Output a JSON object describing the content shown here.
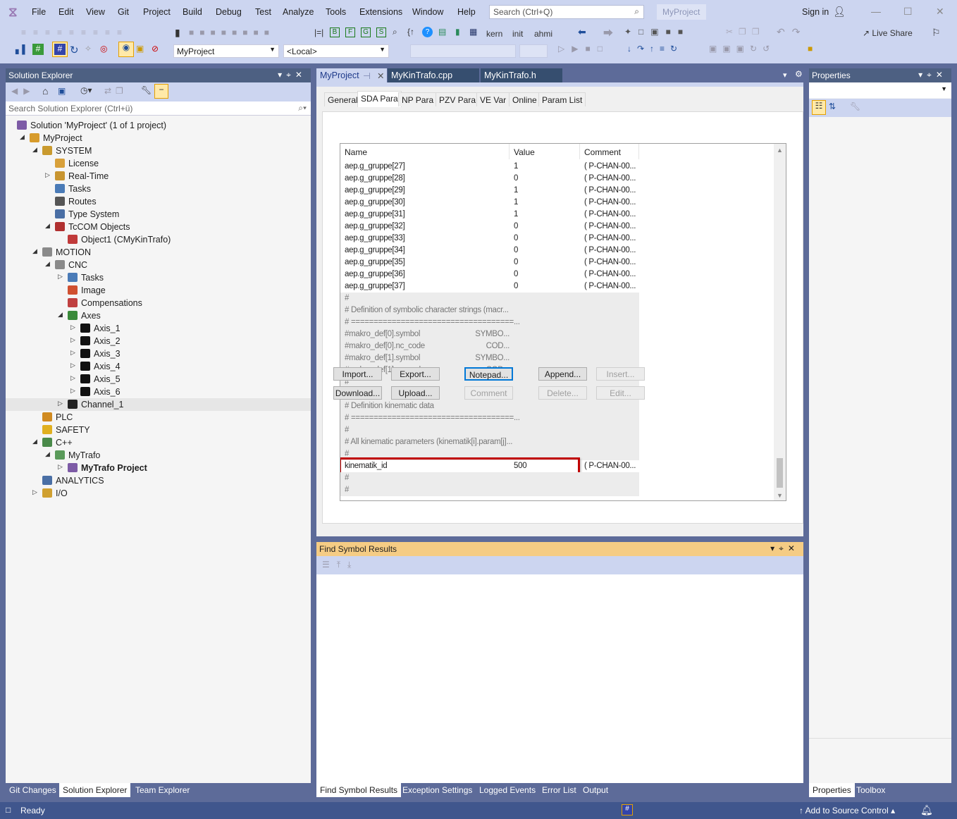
{
  "menu": [
    "File",
    "Edit",
    "View",
    "Git",
    "Project",
    "Build",
    "Debug",
    "Test",
    "Analyze",
    "Tools",
    "Extensions",
    "Window",
    "Help"
  ],
  "search_placeholder": "Search (Ctrl+Q)",
  "project_badge": "MyProject",
  "sign_in": "Sign in",
  "live_share": "Live Share",
  "toolbar": {
    "text_buttons": [
      "kern",
      "init",
      "ahmi"
    ],
    "letter_buttons": [
      "B",
      "F",
      "G",
      "S"
    ],
    "project_combo": "MyProject",
    "target_combo": "<Local>"
  },
  "solution_explorer": {
    "title": "Solution Explorer",
    "search_placeholder": "Search Solution Explorer (Ctrl+ü)",
    "tree": [
      {
        "label": "Solution 'MyProject' (1 of 1 project)",
        "level": 0,
        "exp": "",
        "icon": "solution-icon",
        "color": "#7d5ba6"
      },
      {
        "label": "MyProject",
        "level": 1,
        "exp": "open",
        "icon": "twincat-project-icon",
        "color": "#d79b2b"
      },
      {
        "label": "SYSTEM",
        "level": 2,
        "exp": "open",
        "icon": "system-icon",
        "color": "#c99a2e"
      },
      {
        "label": "License",
        "level": 3,
        "exp": "",
        "icon": "license-icon",
        "color": "#d8a03a"
      },
      {
        "label": "Real-Time",
        "level": 3,
        "exp": "closed",
        "icon": "realtime-icon",
        "color": "#c89530"
      },
      {
        "label": "Tasks",
        "level": 3,
        "exp": "",
        "icon": "tasks-icon",
        "color": "#4a7bb7"
      },
      {
        "label": "Routes",
        "level": 3,
        "exp": "",
        "icon": "routes-icon",
        "color": "#555"
      },
      {
        "label": "Type System",
        "level": 3,
        "exp": "",
        "icon": "type-system-icon",
        "color": "#4a6fa5"
      },
      {
        "label": "TcCOM Objects",
        "level": 3,
        "exp": "open",
        "icon": "tccom-icon",
        "color": "#b03030"
      },
      {
        "label": "Object1 (CMyKinTrafo)",
        "level": 4,
        "exp": "",
        "icon": "object-icon",
        "color": "#c03a3a"
      },
      {
        "label": "MOTION",
        "level": 2,
        "exp": "open",
        "icon": "motion-icon",
        "color": "#8a8a8a"
      },
      {
        "label": "CNC",
        "level": 3,
        "exp": "open",
        "icon": "cnc-icon",
        "color": "#8a8a8a"
      },
      {
        "label": "Tasks",
        "level": 4,
        "exp": "closed",
        "icon": "tasks-icon",
        "color": "#4a7bb7"
      },
      {
        "label": "Image",
        "level": 4,
        "exp": "",
        "icon": "image-icon",
        "color": "#d05030"
      },
      {
        "label": "Compensations",
        "level": 4,
        "exp": "",
        "icon": "compensations-icon",
        "color": "#c04040"
      },
      {
        "label": "Axes",
        "level": 4,
        "exp": "open",
        "icon": "axes-icon",
        "color": "#3a8a3a"
      },
      {
        "label": "Axis_1",
        "level": 5,
        "exp": "closed",
        "icon": "axis-icon",
        "color": "#111"
      },
      {
        "label": "Axis_2",
        "level": 5,
        "exp": "closed",
        "icon": "axis-icon",
        "color": "#111"
      },
      {
        "label": "Axis_3",
        "level": 5,
        "exp": "closed",
        "icon": "axis-icon",
        "color": "#111"
      },
      {
        "label": "Axis_4",
        "level": 5,
        "exp": "closed",
        "icon": "axis-icon",
        "color": "#111"
      },
      {
        "label": "Axis_5",
        "level": 5,
        "exp": "closed",
        "icon": "axis-icon",
        "color": "#111"
      },
      {
        "label": "Axis_6",
        "level": 5,
        "exp": "closed",
        "icon": "axis-icon",
        "color": "#111"
      },
      {
        "label": "Channel_1",
        "level": 4,
        "exp": "closed",
        "icon": "channel-icon",
        "color": "#222",
        "selected": true
      },
      {
        "label": "PLC",
        "level": 2,
        "exp": "",
        "icon": "plc-icon",
        "color": "#d08a20"
      },
      {
        "label": "SAFETY",
        "level": 2,
        "exp": "",
        "icon": "safety-icon",
        "color": "#e0b020"
      },
      {
        "label": "C++",
        "level": 2,
        "exp": "open",
        "icon": "cpp-icon",
        "color": "#4a8a4a"
      },
      {
        "label": "MyTrafo",
        "level": 3,
        "exp": "open",
        "icon": "cpp-module-icon",
        "color": "#5a9a5a"
      },
      {
        "label": "MyTrafo Project",
        "level": 4,
        "exp": "closed",
        "icon": "vcx-project-icon",
        "color": "#7d5ba6",
        "bold": true
      },
      {
        "label": "ANALYTICS",
        "level": 2,
        "exp": "",
        "icon": "analytics-icon",
        "color": "#4a6fa5"
      },
      {
        "label": "I/O",
        "level": 2,
        "exp": "closed",
        "icon": "io-icon",
        "color": "#d0a030"
      }
    ]
  },
  "left_bottom_tabs": [
    "Git Changes",
    "Solution Explorer",
    "Team Explorer"
  ],
  "doc_tabs": [
    "MyProject",
    "MyKinTrafo.cpp",
    "MyKinTrafo.h"
  ],
  "editor": {
    "tabs": [
      "General",
      "SDA Para",
      "NP Para",
      "PZV Para",
      "VE Var",
      "Online",
      "Param List"
    ],
    "active_tab": "SDA Para",
    "columns": [
      "Name",
      "Value",
      "Comment"
    ],
    "rows": [
      {
        "name": "aep.g_gruppe[27]",
        "value": "1",
        "comment": "( P-CHAN-00..."
      },
      {
        "name": "aep.g_gruppe[28]",
        "value": "0",
        "comment": "( P-CHAN-00..."
      },
      {
        "name": "aep.g_gruppe[29]",
        "value": "1",
        "comment": "( P-CHAN-00..."
      },
      {
        "name": "aep.g_gruppe[30]",
        "value": "1",
        "comment": "( P-CHAN-00..."
      },
      {
        "name": "aep.g_gruppe[31]",
        "value": "1",
        "comment": "( P-CHAN-00..."
      },
      {
        "name": "aep.g_gruppe[32]",
        "value": "0",
        "comment": "( P-CHAN-00..."
      },
      {
        "name": "aep.g_gruppe[33]",
        "value": "0",
        "comment": "( P-CHAN-00..."
      },
      {
        "name": "aep.g_gruppe[34]",
        "value": "0",
        "comment": "( P-CHAN-00..."
      },
      {
        "name": "aep.g_gruppe[35]",
        "value": "0",
        "comment": "( P-CHAN-00..."
      },
      {
        "name": "aep.g_gruppe[36]",
        "value": "0",
        "comment": "( P-CHAN-00..."
      },
      {
        "name": "aep.g_gruppe[37]",
        "value": "0",
        "comment": "( P-CHAN-00..."
      },
      {
        "name": "#",
        "value": "",
        "comment": "",
        "c": true
      },
      {
        "name": "# Definition of symbolic character strings (macr...",
        "value": "",
        "comment": "",
        "c": true
      },
      {
        "name": "# ====================================...",
        "value": "",
        "comment": "",
        "c": true
      },
      {
        "name": "#makro_def[0].symbol",
        "value": "SYMBO...",
        "comment": "",
        "c": true
      },
      {
        "name": "#makro_def[0].nc_code",
        "value": "COD...",
        "comment": "",
        "c": true
      },
      {
        "name": "#makro_def[1].symbol",
        "value": "SYMBO...",
        "comment": "",
        "c": true
      },
      {
        "name": "#makro_def[1].nc_code",
        "value": "COD...",
        "comment": "",
        "c": true
      },
      {
        "name": "#",
        "value": "",
        "comment": "",
        "c": true
      },
      {
        "name": "#",
        "value": "",
        "comment": "",
        "c": true
      },
      {
        "name": "# Definition kinematic data",
        "value": "",
        "comment": "",
        "c": true
      },
      {
        "name": "# ====================================...",
        "value": "",
        "comment": "",
        "c": true
      },
      {
        "name": "#",
        "value": "",
        "comment": "",
        "c": true
      },
      {
        "name": "# All kinematic parameters (kinematik[i].param[j]...",
        "value": "",
        "comment": "",
        "c": true
      },
      {
        "name": "#",
        "value": "",
        "comment": "",
        "c": true
      },
      {
        "name": "kinematik_id",
        "value": "500",
        "comment": "( P-CHAN-00...",
        "highlight": true
      },
      {
        "name": "#",
        "value": "",
        "comment": "",
        "c": true
      },
      {
        "name": "#",
        "value": "",
        "comment": "",
        "c": true
      }
    ],
    "buttons_row1": [
      {
        "label": "Import...",
        "enabled": true
      },
      {
        "label": "Export...",
        "enabled": true
      },
      {
        "label": "Notepad...",
        "enabled": true,
        "focus": true
      },
      {
        "label": "Append...",
        "enabled": true
      },
      {
        "label": "Insert...",
        "enabled": false
      }
    ],
    "buttons_row2": [
      {
        "label": "Download...",
        "enabled": true
      },
      {
        "label": "Upload...",
        "enabled": true
      },
      {
        "label": "Comment",
        "enabled": false
      },
      {
        "label": "Delete...",
        "enabled": false
      },
      {
        "label": "Edit...",
        "enabled": false
      }
    ],
    "highlight_color": "#c00000"
  },
  "find_symbol": {
    "title": "Find Symbol Results"
  },
  "center_bottom_tabs": [
    "Find Symbol Results",
    "Exception Settings",
    "Logged Events",
    "Error List",
    "Output"
  ],
  "properties": {
    "title": "Properties"
  },
  "right_bottom_tabs": [
    "Properties",
    "Toolbox"
  ],
  "status": {
    "text": "Ready",
    "source_control": "Add to Source Control"
  }
}
